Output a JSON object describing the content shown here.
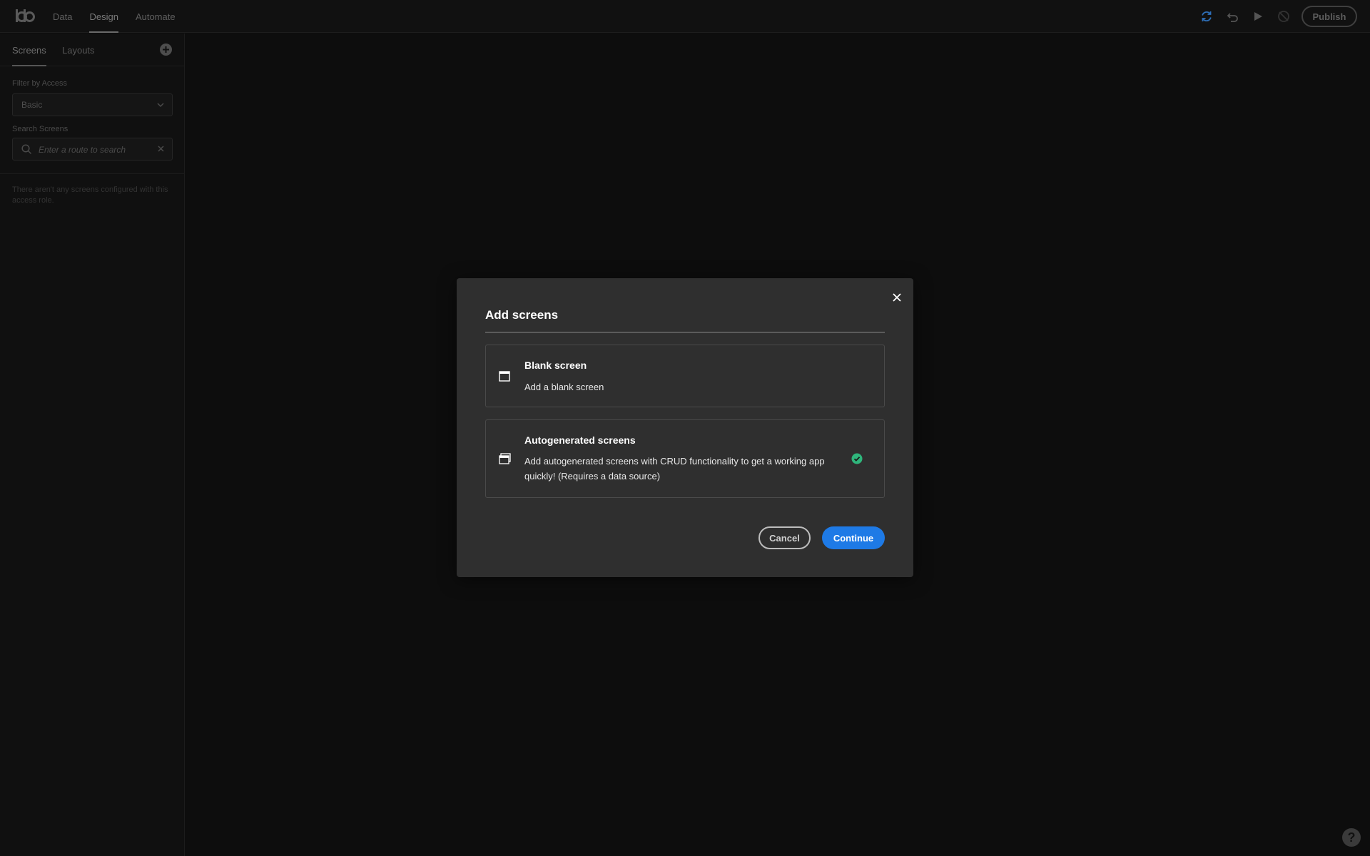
{
  "topbar": {
    "logo": "bb",
    "tabs": [
      {
        "label": "Data",
        "active": false
      },
      {
        "label": "Design",
        "active": true
      },
      {
        "label": "Automate",
        "active": false
      }
    ],
    "icons": [
      "refresh-icon",
      "revert-icon",
      "play-icon",
      "unpublish-icon"
    ],
    "publish_label": "Publish"
  },
  "sidebar": {
    "tabs": [
      {
        "label": "Screens",
        "active": true
      },
      {
        "label": "Layouts",
        "active": false
      }
    ],
    "filter_label": "Filter by Access",
    "filter_value": "Basic",
    "search_label": "Search Screens",
    "search_placeholder": "Enter a route to search",
    "empty_message": "There aren't any screens configured with this access role."
  },
  "modal": {
    "title": "Add screens",
    "options": [
      {
        "title": "Blank screen",
        "description": "Add a blank screen",
        "icon": "screen-icon",
        "selected": false
      },
      {
        "title": "Autogenerated screens",
        "description": "Add autogenerated screens with CRUD functionality to get a working app quickly! (Requires a data source)",
        "icon": "screens-stack-icon",
        "selected": true
      }
    ],
    "cancel_label": "Cancel",
    "continue_label": "Continue"
  },
  "help_label": "?",
  "colors": {
    "accent": "#1e7ae6",
    "selected_check": "#2fb67c",
    "modal_bg": "#2f2f2f",
    "page_bg": "#0d0d0d"
  }
}
